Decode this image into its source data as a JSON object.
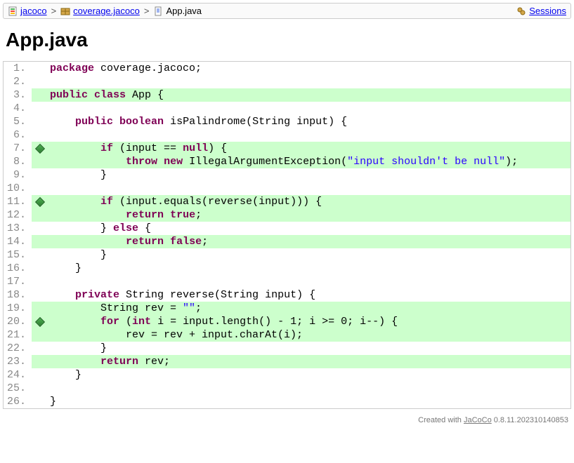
{
  "breadcrumb": {
    "root": "jacoco",
    "package": "coverage.jacoco",
    "file": "App.java",
    "sessions": "Sessions"
  },
  "title": "App.java",
  "lines": [
    {
      "n": "1.",
      "hl": false,
      "diamond": false,
      "tokens": [
        {
          "t": "kw",
          "v": "package"
        },
        {
          "t": "pl",
          "v": " coverage.jacoco;"
        }
      ]
    },
    {
      "n": "2.",
      "hl": false,
      "diamond": false,
      "tokens": []
    },
    {
      "n": "3.",
      "hl": true,
      "diamond": false,
      "tokens": [
        {
          "t": "kw",
          "v": "public"
        },
        {
          "t": "pl",
          "v": " "
        },
        {
          "t": "kw",
          "v": "class"
        },
        {
          "t": "pl",
          "v": " App {"
        }
      ]
    },
    {
      "n": "4.",
      "hl": false,
      "diamond": false,
      "tokens": []
    },
    {
      "n": "5.",
      "hl": false,
      "diamond": false,
      "tokens": [
        {
          "t": "pl",
          "v": "    "
        },
        {
          "t": "kw",
          "v": "public"
        },
        {
          "t": "pl",
          "v": " "
        },
        {
          "t": "kw",
          "v": "boolean"
        },
        {
          "t": "pl",
          "v": " isPalindrome(String input) {"
        }
      ]
    },
    {
      "n": "6.",
      "hl": false,
      "diamond": false,
      "tokens": []
    },
    {
      "n": "7.",
      "hl": true,
      "diamond": true,
      "tokens": [
        {
          "t": "pl",
          "v": "        "
        },
        {
          "t": "kw",
          "v": "if"
        },
        {
          "t": "pl",
          "v": " (input == "
        },
        {
          "t": "kw",
          "v": "null"
        },
        {
          "t": "pl",
          "v": ") {"
        }
      ]
    },
    {
      "n": "8.",
      "hl": true,
      "diamond": false,
      "tokens": [
        {
          "t": "pl",
          "v": "            "
        },
        {
          "t": "kw",
          "v": "throw"
        },
        {
          "t": "pl",
          "v": " "
        },
        {
          "t": "kw",
          "v": "new"
        },
        {
          "t": "pl",
          "v": " IllegalArgumentException("
        },
        {
          "t": "str",
          "v": "\"input shouldn't be null\""
        },
        {
          "t": "pl",
          "v": ");"
        }
      ]
    },
    {
      "n": "9.",
      "hl": false,
      "diamond": false,
      "tokens": [
        {
          "t": "pl",
          "v": "        }"
        }
      ]
    },
    {
      "n": "10.",
      "hl": false,
      "diamond": false,
      "tokens": []
    },
    {
      "n": "11.",
      "hl": true,
      "diamond": true,
      "tokens": [
        {
          "t": "pl",
          "v": "        "
        },
        {
          "t": "kw",
          "v": "if"
        },
        {
          "t": "pl",
          "v": " (input.equals(reverse(input))) {"
        }
      ]
    },
    {
      "n": "12.",
      "hl": true,
      "diamond": false,
      "tokens": [
        {
          "t": "pl",
          "v": "            "
        },
        {
          "t": "kw",
          "v": "return"
        },
        {
          "t": "pl",
          "v": " "
        },
        {
          "t": "kw",
          "v": "true"
        },
        {
          "t": "pl",
          "v": ";"
        }
      ]
    },
    {
      "n": "13.",
      "hl": false,
      "diamond": false,
      "tokens": [
        {
          "t": "pl",
          "v": "        } "
        },
        {
          "t": "kw",
          "v": "else"
        },
        {
          "t": "pl",
          "v": " {"
        }
      ]
    },
    {
      "n": "14.",
      "hl": true,
      "diamond": false,
      "tokens": [
        {
          "t": "pl",
          "v": "            "
        },
        {
          "t": "kw",
          "v": "return"
        },
        {
          "t": "pl",
          "v": " "
        },
        {
          "t": "kw",
          "v": "false"
        },
        {
          "t": "pl",
          "v": ";"
        }
      ]
    },
    {
      "n": "15.",
      "hl": false,
      "diamond": false,
      "tokens": [
        {
          "t": "pl",
          "v": "        }"
        }
      ]
    },
    {
      "n": "16.",
      "hl": false,
      "diamond": false,
      "tokens": [
        {
          "t": "pl",
          "v": "    }"
        }
      ]
    },
    {
      "n": "17.",
      "hl": false,
      "diamond": false,
      "tokens": []
    },
    {
      "n": "18.",
      "hl": false,
      "diamond": false,
      "tokens": [
        {
          "t": "pl",
          "v": "    "
        },
        {
          "t": "kw",
          "v": "private"
        },
        {
          "t": "pl",
          "v": " String reverse(String input) {"
        }
      ]
    },
    {
      "n": "19.",
      "hl": true,
      "diamond": false,
      "tokens": [
        {
          "t": "pl",
          "v": "        String rev = "
        },
        {
          "t": "str",
          "v": "\"\""
        },
        {
          "t": "pl",
          "v": ";"
        }
      ]
    },
    {
      "n": "20.",
      "hl": true,
      "diamond": true,
      "tokens": [
        {
          "t": "pl",
          "v": "        "
        },
        {
          "t": "kw",
          "v": "for"
        },
        {
          "t": "pl",
          "v": " ("
        },
        {
          "t": "kw",
          "v": "int"
        },
        {
          "t": "pl",
          "v": " i = input.length() - 1; i >= 0; i--) {"
        }
      ]
    },
    {
      "n": "21.",
      "hl": true,
      "diamond": false,
      "tokens": [
        {
          "t": "pl",
          "v": "            rev = rev + input.charAt(i);"
        }
      ]
    },
    {
      "n": "22.",
      "hl": false,
      "diamond": false,
      "tokens": [
        {
          "t": "pl",
          "v": "        }"
        }
      ]
    },
    {
      "n": "23.",
      "hl": true,
      "diamond": false,
      "tokens": [
        {
          "t": "pl",
          "v": "        "
        },
        {
          "t": "kw",
          "v": "return"
        },
        {
          "t": "pl",
          "v": " rev;"
        }
      ]
    },
    {
      "n": "24.",
      "hl": false,
      "diamond": false,
      "tokens": [
        {
          "t": "pl",
          "v": "    }"
        }
      ]
    },
    {
      "n": "25.",
      "hl": false,
      "diamond": false,
      "tokens": []
    },
    {
      "n": "26.",
      "hl": false,
      "diamond": false,
      "tokens": [
        {
          "t": "pl",
          "v": "}"
        }
      ]
    }
  ],
  "footer": {
    "prefix": "Created with ",
    "link": "JaCoCo",
    "suffix": " 0.8.11.202310140853"
  }
}
